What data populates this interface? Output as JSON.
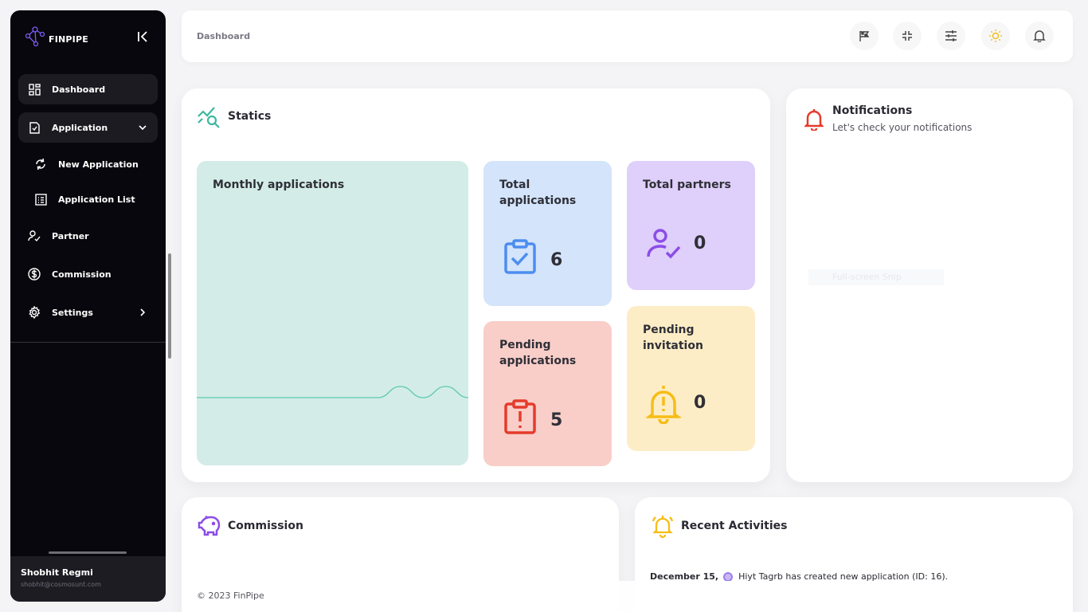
{
  "app": {
    "name": "FINPIPE"
  },
  "sidebar": {
    "items": [
      {
        "label": "Dashboard",
        "icon": "grid-icon"
      },
      {
        "label": "Application",
        "icon": "file-check-icon"
      },
      {
        "label": "New Application",
        "icon": "refresh-icon"
      },
      {
        "label": "Application List",
        "icon": "list-icon"
      },
      {
        "label": "Partner",
        "icon": "user-check-icon"
      },
      {
        "label": "Commission",
        "icon": "dollar-circle-icon"
      },
      {
        "label": "Settings",
        "icon": "gear-icon"
      }
    ],
    "user": {
      "name": "Shobhit Regmi",
      "email": "shobhit@cosmosunt.com"
    }
  },
  "header": {
    "title": "Dashboard"
  },
  "statics": {
    "title": "Statics",
    "monthly_label": "Monthly applications",
    "tiles": [
      {
        "label": "Total applications",
        "value": "6",
        "bg": "#d3e4fb",
        "icon_color": "#4c8df0"
      },
      {
        "label": "Total partners",
        "value": "0",
        "bg": "#decffb",
        "icon_color": "#8c4ce8"
      },
      {
        "label": "Pending applications",
        "value": "5",
        "bg": "#f9cec8",
        "icon_color": "#e53b2c"
      },
      {
        "label": "Pending invitation",
        "value": "0",
        "bg": "#fdedc6",
        "icon_color": "#f6bd16"
      }
    ],
    "chart_bg": "#d3ece7",
    "line_color": "#5ec9b2"
  },
  "chart_data": {
    "type": "line",
    "title": "Monthly applications",
    "series": [
      {
        "values": [
          0,
          0,
          0,
          0,
          0,
          0,
          0,
          0,
          0,
          1,
          0,
          1,
          0
        ]
      }
    ]
  },
  "notifications": {
    "title": "Notifications",
    "subtitle": "Let's check your notifications",
    "ghost": "Full-screen Snip"
  },
  "commission": {
    "title": "Commission"
  },
  "recent": {
    "title": "Recent Activities",
    "items": [
      {
        "date": "December 15,",
        "text": "Hiyt Tagrb has created new application (ID: 16)."
      }
    ]
  },
  "footer": {
    "text": "© 2023 FinPipe"
  }
}
